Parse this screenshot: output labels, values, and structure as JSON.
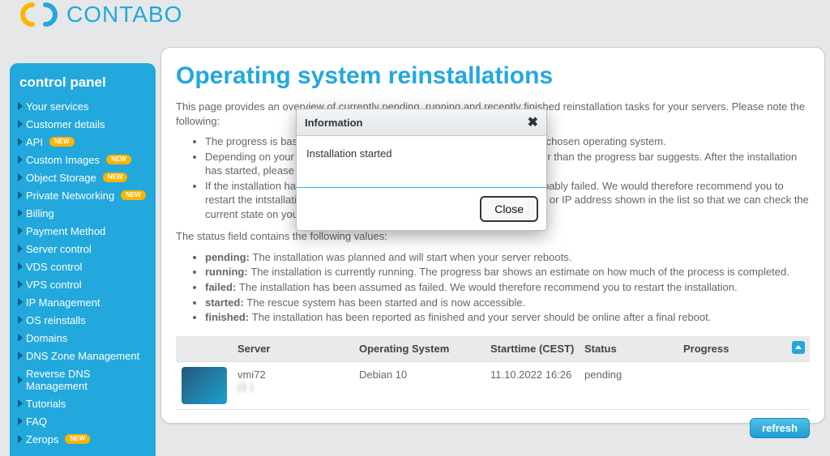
{
  "brand": {
    "name": "CONTABO"
  },
  "sidebar": {
    "title": "control panel",
    "items": [
      {
        "label": "Your services",
        "badge": false
      },
      {
        "label": "Customer details",
        "badge": false
      },
      {
        "label": "API",
        "badge": true
      },
      {
        "label": "Custom Images",
        "badge": true
      },
      {
        "label": "Object Storage",
        "badge": true
      },
      {
        "label": "Private Networking",
        "badge": true
      },
      {
        "label": "Billing",
        "badge": false
      },
      {
        "label": "Payment Method",
        "badge": false
      },
      {
        "label": "Server control",
        "badge": false
      },
      {
        "label": "VDS control",
        "badge": false
      },
      {
        "label": "VPS control",
        "badge": false
      },
      {
        "label": "IP Management",
        "badge": false
      },
      {
        "label": "OS reinstalls",
        "badge": false
      },
      {
        "label": "Domains",
        "badge": false
      },
      {
        "label": "DNS Zone Management",
        "badge": false
      },
      {
        "label": "Reverse DNS Management",
        "badge": false
      },
      {
        "label": "Tutorials",
        "badge": false
      },
      {
        "label": "FAQ",
        "badge": false
      },
      {
        "label": "Zerops",
        "badge": true
      }
    ],
    "badge_text": "NEW"
  },
  "main": {
    "title": "Operating system reinstallations",
    "intro": "This page provides an overview of currently pending, running and recently finished reinstallation tasks for your servers. Please note the following:",
    "notes": [
      "The progress is based on a conservative estimate which depends on the chosen operating system.",
      "Depending on your server's configuration the installation might take longer than the progress bar suggests. After the installation has started, please wait until it's done.",
      "If the installation has not finished after 2 hours we assume that it has probably failed. We would therefore recommend you to restart the intstallation. When doing so, please select the exact hostname or IP address shown in the list so that we can check the current state on your server."
    ],
    "status_intro": "The status field contains the following values:",
    "status_defs": [
      {
        "k": "pending:",
        "v": "The installation was planned and will start when your server reboots."
      },
      {
        "k": "running:",
        "v": "The installation is currently running. The progress bar shows an estimate on how much of the process is completed."
      },
      {
        "k": "failed:",
        "v": "The installation has been assumed as failed. We would therefore recommend you to restart the installation."
      },
      {
        "k": "started:",
        "v": "The rescue system has been started and is now accessible."
      },
      {
        "k": "finished:",
        "v": "The installation has been reported as finished and your server should be online after a final reboot."
      }
    ],
    "table": {
      "headers": {
        "server": "Server",
        "os": "Operating System",
        "start": "Starttime (CEST)",
        "status": "Status",
        "progress": "Progress"
      },
      "row": {
        "server_line1": "vmi72",
        "server_line2": "(1                         )",
        "os": "Debian 10",
        "start": "11.10.2022 16:26",
        "status": "pending"
      }
    },
    "refresh": "refresh"
  },
  "modal": {
    "title": "Information",
    "body": "Installation started",
    "close": "Close"
  }
}
